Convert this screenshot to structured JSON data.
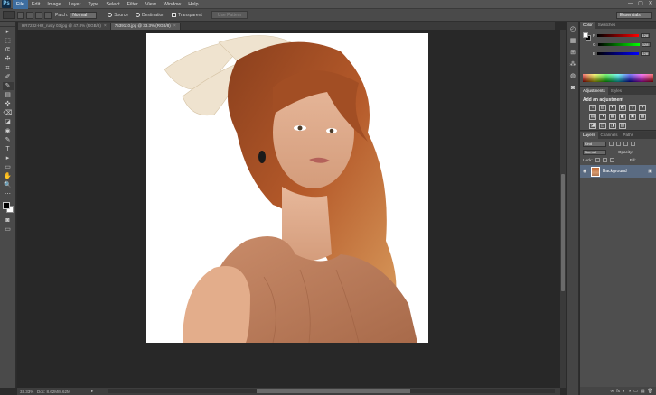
{
  "app": {
    "logo": "Ps"
  },
  "menu": {
    "items": [
      "File",
      "Edit",
      "Image",
      "Layer",
      "Type",
      "Select",
      "Filter",
      "View",
      "Window",
      "Help"
    ],
    "active_index": 0
  },
  "window_controls": {
    "minimize": "—",
    "maximize": "▢",
    "close": "✕"
  },
  "options": {
    "patch_label": "Patch:",
    "patch_value": "Normal",
    "source_label": "Source",
    "destination_label": "Destination",
    "transparent_label": "Transparent",
    "use_pattern_label": "Use Pattern",
    "workspace": "Essentials"
  },
  "tabs": [
    {
      "label": "HR7232-HR_rusty 03.jpg @ 47.8% (RGB/8)",
      "close": "×"
    },
    {
      "label": "7539110.jpg @ 33.3% (RGB/8)",
      "close": "×"
    }
  ],
  "active_tab": 1,
  "status": {
    "zoom": "33.33%",
    "doc": "Doc: 8.62M/8.62M",
    "arrow": "▸"
  },
  "color_panel": {
    "tabs": [
      "Color",
      "Swatches"
    ],
    "r_label": "R",
    "g_label": "G",
    "b_label": "B",
    "r_value": "128",
    "g_value": "128",
    "b_value": "128"
  },
  "adjustments_panel": {
    "tabs": [
      "Adjustments",
      "Styles"
    ],
    "title": "Add an adjustment",
    "icons": [
      "☼",
      "▥",
      "◐",
      "◩",
      "▽",
      "▼",
      "▤",
      "◑",
      "▦",
      "◧",
      "▣",
      "▩",
      "◪",
      "◫",
      "◨",
      "▧"
    ]
  },
  "layers_panel": {
    "tabs": [
      "Layers",
      "Channels",
      "Paths"
    ],
    "kind": "Kind",
    "blend_mode": "Normal",
    "opacity_label": "Opacity:",
    "lock_label": "Lock:",
    "fill_label": "Fill:",
    "layer_name": "Background",
    "bottom_icons": [
      "∞",
      "fx",
      "◐",
      "◑",
      "▭",
      "▤",
      "🗑"
    ]
  },
  "tools": [
    "▸",
    "⬚",
    "ᕳ",
    "✣",
    "⌗",
    "✐",
    "✎",
    "▤",
    "✜",
    "⌫",
    "◪",
    "◉",
    "✎",
    "T",
    "▸",
    "▭",
    "✋",
    "🔍",
    "⋯"
  ],
  "strip_icons": [
    "◴",
    "▦",
    "⊞",
    "⁂",
    "◍",
    "◙"
  ],
  "colors": {
    "selected_layer": "#5a6b82",
    "active_menu": "#3e6ea0",
    "canvas_bg": "#282828"
  }
}
